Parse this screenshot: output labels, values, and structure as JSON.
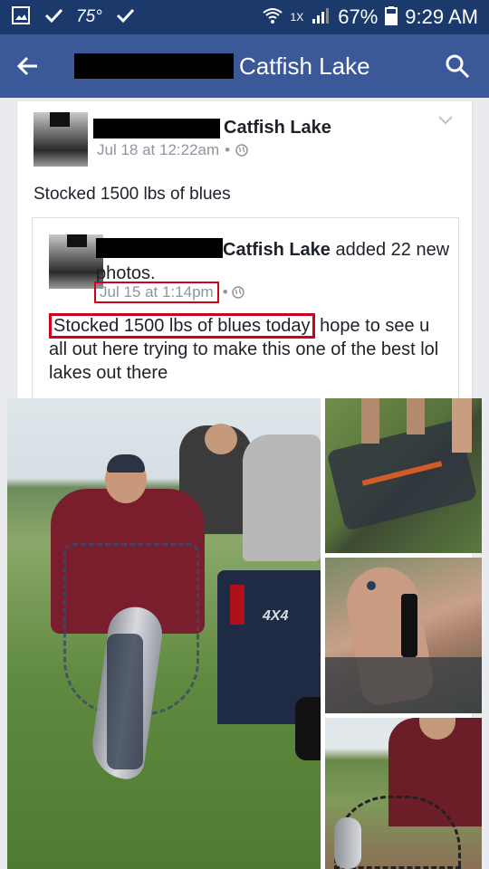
{
  "status_bar": {
    "temperature": "75°",
    "network": "1X",
    "battery": "67%",
    "time": "9:29 AM"
  },
  "app_bar": {
    "title": "Catfish Lake"
  },
  "post": {
    "author_suffix": "Catfish Lake",
    "timestamp": "Jul 18 at 12:22am",
    "separator": "•",
    "text": "Stocked 1500 lbs of blues"
  },
  "shared_post": {
    "author_suffix": "Catfish Lake",
    "action": " added 22 new photos.",
    "timestamp": "Jul 15 at 1:14pm",
    "separator": "•",
    "highlighted_text": "Stocked 1500 lbs of blues today",
    "rest_text": " hope to see u all out here trying to make this one of the best lol lakes out there"
  },
  "photos": {
    "truck_label": "4X4"
  },
  "colors": {
    "status_bar": "#1b3a6b",
    "app_bar": "#3b5998",
    "highlight_red": "#d0021b"
  }
}
